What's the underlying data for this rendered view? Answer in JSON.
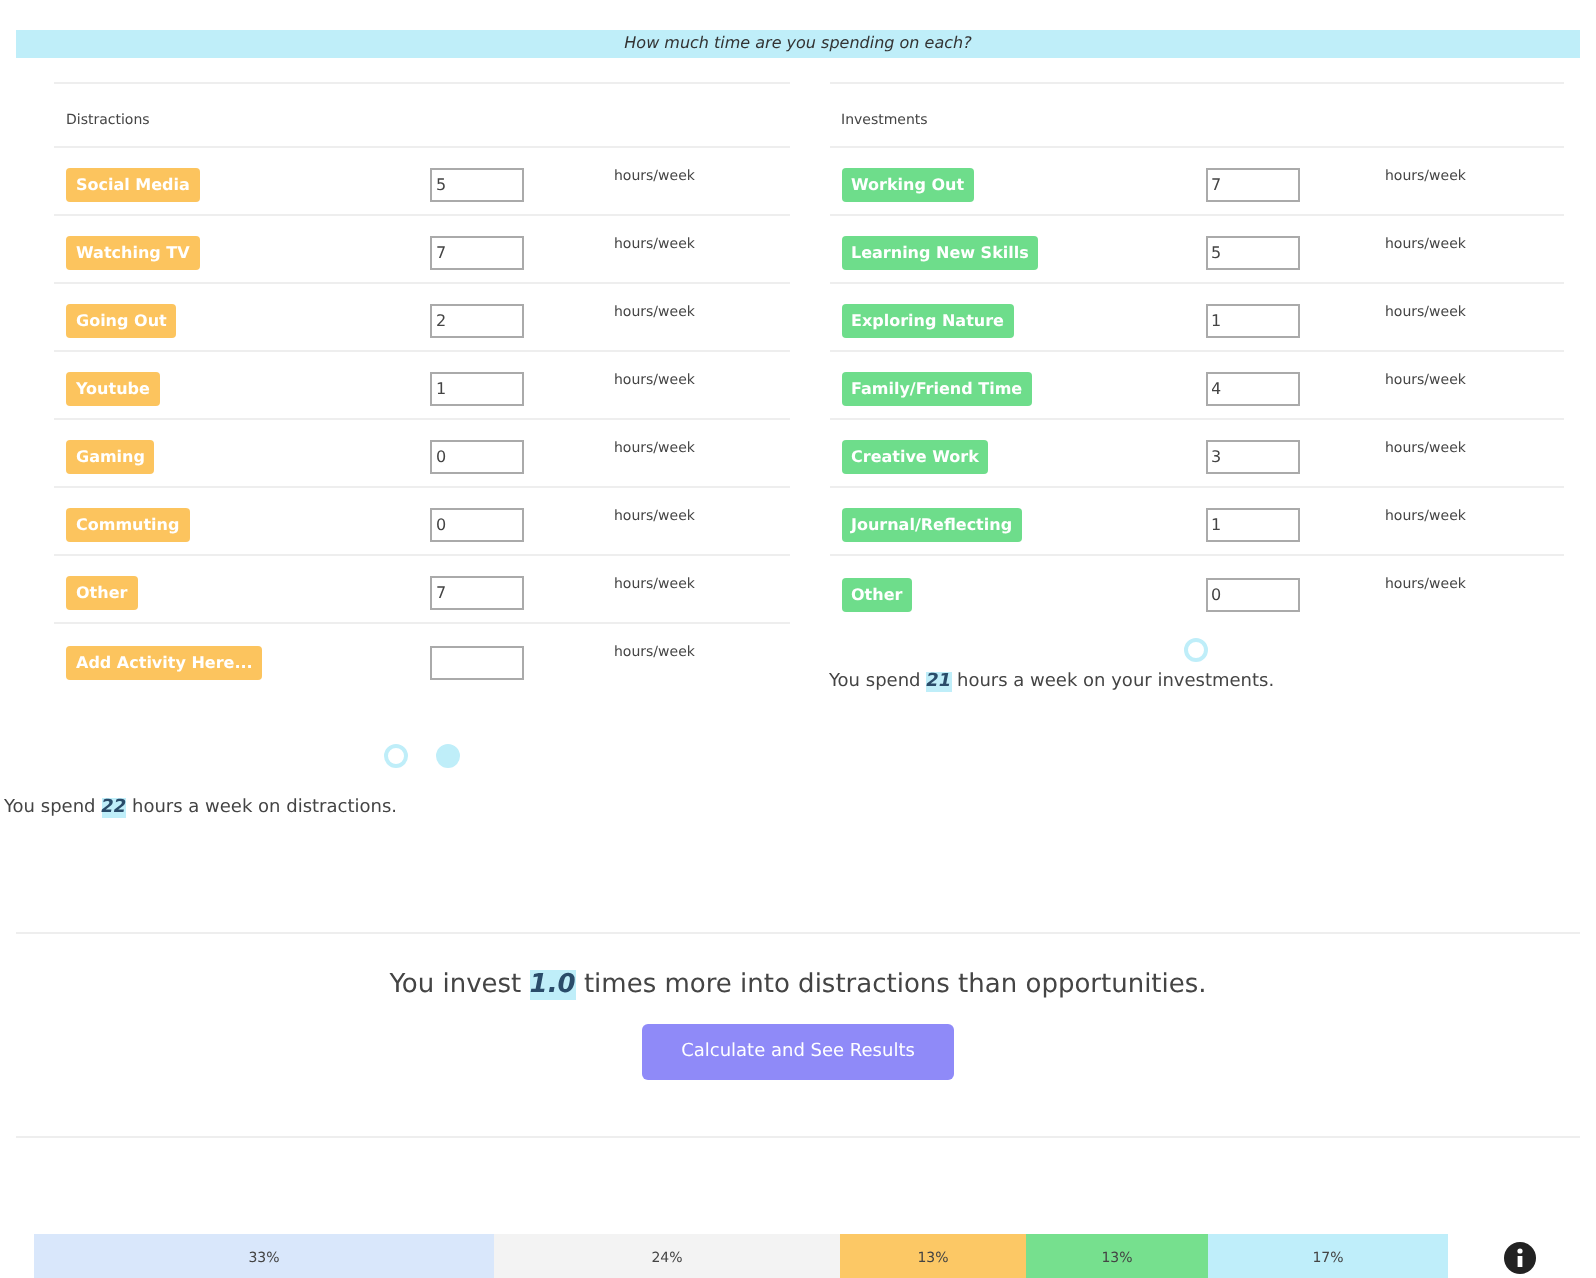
{
  "banner": "How much time are you spending on each?",
  "columns": [
    {
      "kind": "distraction",
      "heading": "Distractions",
      "rows": [
        {
          "label": "Social Media",
          "value": "5",
          "unit": "hours/week"
        },
        {
          "label": "Watching TV",
          "value": "7",
          "unit": "hours/week"
        },
        {
          "label": "Going Out",
          "value": "2",
          "unit": "hours/week"
        },
        {
          "label": "Youtube",
          "value": "1",
          "unit": "hours/week"
        },
        {
          "label": "Gaming",
          "value": "0",
          "unit": "hours/week"
        },
        {
          "label": "Commuting",
          "value": "0",
          "unit": "hours/week"
        },
        {
          "label": "Other",
          "value": "7",
          "unit": "hours/week"
        },
        {
          "label": "Add Activity Here...",
          "unit": "hours/week"
        }
      ],
      "controls": [
        {
          "kind": "add"
        },
        {
          "kind": "remove"
        }
      ],
      "summary": "You spend **22** hours a week on distractions."
    },
    {
      "kind": "investment",
      "heading": "Investments",
      "rows": [
        {
          "label": "Working Out",
          "value": "7",
          "unit": "hours/week"
        },
        {
          "label": "Learning New Skills",
          "value": "5",
          "unit": "hours/week"
        },
        {
          "label": "Exploring Nature",
          "value": "1",
          "unit": "hours/week"
        },
        {
          "label": "Family/Friend Time",
          "value": "4",
          "unit": "hours/week"
        },
        {
          "label": "Creative Work",
          "value": "3",
          "unit": "hours/week"
        },
        {
          "label": "Journal/Reflecting",
          "value": "1",
          "unit": "hours/week"
        },
        {
          "label": "Other",
          "value": "0",
          "unit": "hours/week"
        }
      ],
      "controls": [
        {
          "kind": "add"
        }
      ],
      "summary": "You spend **21** hours a week on your investments."
    }
  ],
  "ratio": "You invest **1.0** times more into distractions than opportunities.",
  "button": "Calculate and See Results",
  "breakdown": [
    {
      "label": "33%",
      "color": "#d9e7fb"
    },
    {
      "label": "24%",
      "color": "#f3f3f3"
    },
    {
      "label": "13%",
      "color": "#fcc865"
    },
    {
      "label": "13%",
      "color": "#76e08e"
    },
    {
      "label": "17%",
      "color": "#bfeefa"
    }
  ]
}
